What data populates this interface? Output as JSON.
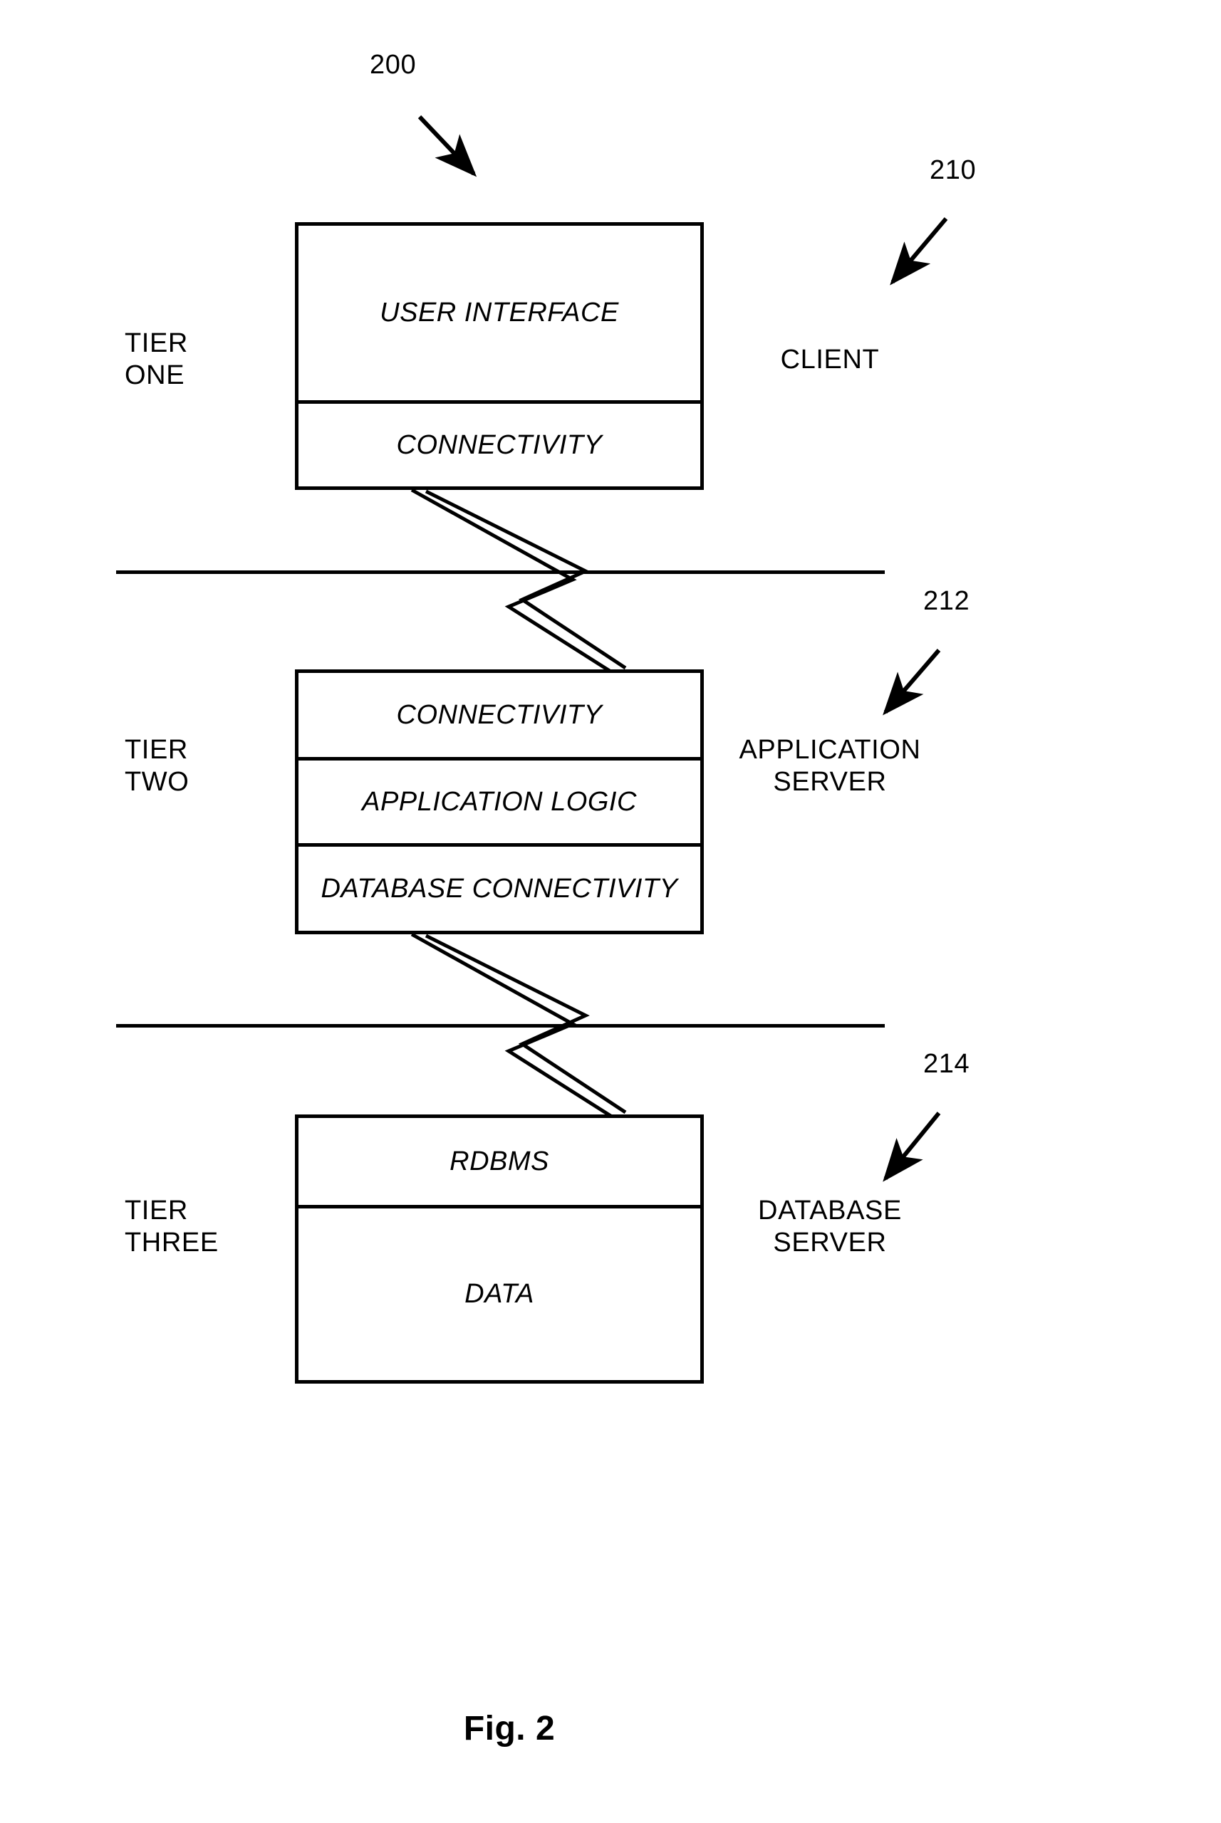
{
  "figure": {
    "caption": "Fig. 2",
    "system_ref": "200"
  },
  "tiers": [
    {
      "name": "TIER\nONE",
      "ref": "210",
      "component": "CLIENT",
      "cells": [
        {
          "label": "USER INTERFACE"
        },
        {
          "label": "CONNECTIVITY"
        }
      ]
    },
    {
      "name": "TIER\nTWO",
      "ref": "212",
      "component": "APPLICATION\nSERVER",
      "cells": [
        {
          "label": "CONNECTIVITY"
        },
        {
          "label": "APPLICATION LOGIC"
        },
        {
          "label": "DATABASE CONNECTIVITY"
        }
      ]
    },
    {
      "name": "TIER\nTHREE",
      "ref": "214",
      "component": "DATABASE\nSERVER",
      "cells": [
        {
          "label": "RDBMS"
        },
        {
          "label": "DATA"
        }
      ]
    }
  ],
  "connectors": [
    {
      "name": "tier-one-to-tier-two-link"
    },
    {
      "name": "tier-two-to-tier-three-link"
    }
  ],
  "separators": [
    {
      "name": "client-app-boundary"
    },
    {
      "name": "app-db-boundary"
    }
  ],
  "colors": {
    "ink": "#000000",
    "paper": "#ffffff"
  }
}
